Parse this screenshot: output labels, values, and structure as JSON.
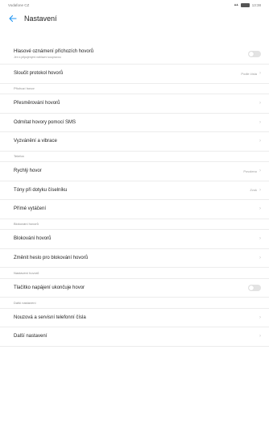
{
  "status": {
    "carrier": "Vodafone CZ",
    "time": "13:38"
  },
  "header": {
    "title": "Nastavení"
  },
  "rows": [
    {
      "type": "item",
      "label": "Hlasové oznámení příchozích hovorů",
      "sub": "Jen s připojenými náhlavní soupravou",
      "control": "toggle",
      "tall": true
    },
    {
      "type": "item",
      "label": "Sloučit protokol hovorů",
      "value": "Podle čísla",
      "control": "chevron"
    },
    {
      "type": "category",
      "label": "Příchozí hovor"
    },
    {
      "type": "item",
      "label": "Přesměrování hovorů",
      "control": "chevron"
    },
    {
      "type": "item",
      "label": "Odmítat hovory pomocí SMS",
      "control": "chevron"
    },
    {
      "type": "item",
      "label": "Vyzvánění a vibrace",
      "control": "chevron"
    },
    {
      "type": "category",
      "label": "Telefon"
    },
    {
      "type": "item",
      "label": "Rychlý hovor",
      "value": "Povoleno",
      "control": "chevron"
    },
    {
      "type": "item",
      "label": "Tóny při dotyku číselníku",
      "value": "Zvuk",
      "control": "chevron"
    },
    {
      "type": "item",
      "label": "Přímé vytáčení",
      "control": "chevron"
    },
    {
      "type": "category",
      "label": "Blokování hovorů"
    },
    {
      "type": "item",
      "label": "Blokování hovorů",
      "control": "chevron"
    },
    {
      "type": "item",
      "label": "Změnit heslo pro blokování hovorů",
      "control": "chevron"
    },
    {
      "type": "category",
      "label": "Nastavení hovorů"
    },
    {
      "type": "item",
      "label": "Tlačítko napájení ukončuje hovor",
      "control": "toggle"
    },
    {
      "type": "category",
      "label": "Další nastavení"
    },
    {
      "type": "item",
      "label": "Nouzová a servisní telefonní čísla",
      "control": "chevron"
    },
    {
      "type": "item",
      "label": "Další nastavení",
      "control": "chevron"
    }
  ]
}
